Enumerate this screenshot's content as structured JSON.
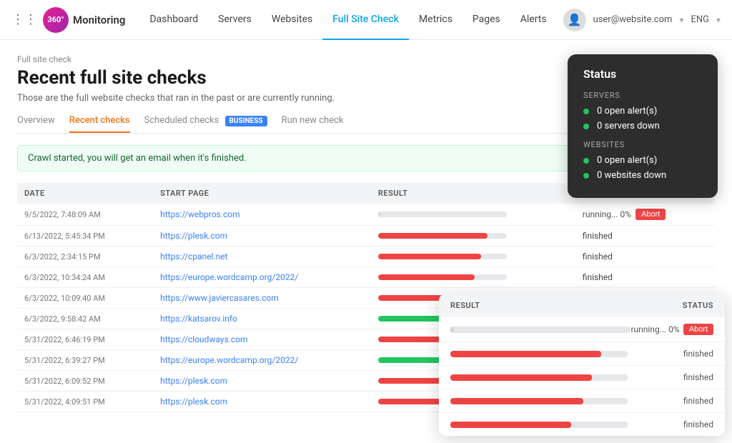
{
  "nav": {
    "grid_icon": "⋮⋮⋮",
    "logo_text": "Monitoring",
    "logo_initials": "360°",
    "links": [
      {
        "label": "Dashboard",
        "active": false
      },
      {
        "label": "Servers",
        "active": false
      },
      {
        "label": "Websites",
        "active": false
      },
      {
        "label": "Full Site Check",
        "active": true
      },
      {
        "label": "Metrics",
        "active": false
      },
      {
        "label": "Pages",
        "active": false
      },
      {
        "label": "Alerts",
        "active": false
      }
    ],
    "user_email": "user@website.com",
    "lang": "ENG"
  },
  "page": {
    "breadcrumb": "Full site check",
    "title": "Recent full site checks",
    "subtitle": "Those are the full website checks that ran in the past or are currently running."
  },
  "tabs": [
    {
      "label": "Overview",
      "active": false,
      "badge": null
    },
    {
      "label": "Recent checks",
      "active": true,
      "badge": null
    },
    {
      "label": "Scheduled checks",
      "active": false,
      "badge": "BUSINESS"
    },
    {
      "label": "Run new check",
      "active": false,
      "badge": null
    }
  ],
  "alert_message": "Crawl started, you will get an email when it's finished.",
  "table": {
    "columns": [
      "DATE",
      "START PAGE",
      "RESULT",
      "STATUS"
    ],
    "rows": [
      {
        "date": "9/5/2022, 7:48:09 AM",
        "url": "https://webpros.com",
        "progress": 2,
        "progress_type": "gray",
        "status": "running",
        "running_pct": "0%"
      },
      {
        "date": "6/13/2022, 5:45:34 PM",
        "url": "https://plesk.com",
        "progress": 85,
        "progress_type": "red",
        "status": "finished",
        "running_pct": null
      },
      {
        "date": "6/3/2022, 2:34:15 PM",
        "url": "https://cpanel.net",
        "progress": 80,
        "progress_type": "red",
        "status": "finished",
        "running_pct": null
      },
      {
        "date": "6/3/2022, 10:34:24 AM",
        "url": "https://europe.wordcamp.org/2022/",
        "progress": 75,
        "progress_type": "red",
        "status": "finished",
        "running_pct": null
      },
      {
        "date": "6/3/2022, 10:09:40 AM",
        "url": "https://www.javiercasares.com",
        "progress": 70,
        "progress_type": "red",
        "status": "finished",
        "running_pct": null
      },
      {
        "date": "6/3/2022, 9:58:42 AM",
        "url": "https://katsarov.info",
        "progress": 65,
        "progress_type": "green",
        "status": "finished",
        "running_pct": null
      },
      {
        "date": "5/31/2022, 6:46:19 PM",
        "url": "https://cloudways.com",
        "progress": 78,
        "progress_type": "red",
        "status": "finished",
        "running_pct": null
      },
      {
        "date": "5/31/2022, 6:39:27 PM",
        "url": "https://europe.wordcamp.org/2022/",
        "progress": 70,
        "progress_type": "green",
        "status": "finished",
        "running_pct": null
      },
      {
        "date": "5/31/2022, 6:09:52 PM",
        "url": "https://plesk.com",
        "progress": 72,
        "progress_type": "red",
        "status": "finished",
        "running_pct": null
      },
      {
        "date": "5/31/2022, 4:09:51 PM",
        "url": "https://plesk.com",
        "progress": 68,
        "progress_type": "red",
        "status": "finished",
        "running_pct": null
      }
    ]
  },
  "status_panel": {
    "title": "Status",
    "servers_label": "SERVERS",
    "servers_items": [
      {
        "text": "0 open alert(s)",
        "color": "#22c55e"
      },
      {
        "text": "0 servers down",
        "color": "#22c55e"
      }
    ],
    "websites_label": "WEBSITES",
    "websites_items": [
      {
        "text": "0 open alert(s)",
        "color": "#22c55e"
      },
      {
        "text": "0 websites down",
        "color": "#22c55e"
      }
    ]
  },
  "popup": {
    "col_result": "RESULT",
    "col_status": "STATUS",
    "rows": [
      {
        "progress": 2,
        "type": "gray",
        "status": "running",
        "pct": "0%"
      },
      {
        "progress": 85,
        "type": "red",
        "status": "finished",
        "pct": null
      },
      {
        "progress": 80,
        "type": "red",
        "status": "finished",
        "pct": null
      },
      {
        "progress": 75,
        "type": "red",
        "status": "finished",
        "pct": null
      },
      {
        "progress": 68,
        "type": "red",
        "status": "finished",
        "pct": null
      }
    ],
    "abort_label": "Abort",
    "finished_label": "finished",
    "running_prefix": "running..."
  }
}
